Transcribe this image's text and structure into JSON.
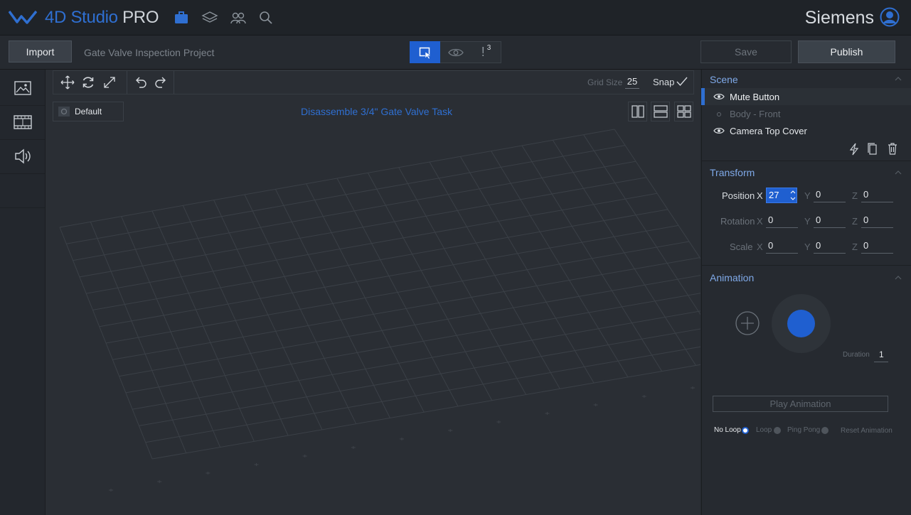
{
  "app": {
    "brand_main": "4D Studio",
    "brand_suffix": "PRO",
    "organization": "Siemens",
    "icons": [
      "logo-icon",
      "briefcase-icon",
      "layers-icon",
      "users-icon",
      "search-icon",
      "user-avatar-icon"
    ],
    "accent": "#2f6fd1"
  },
  "toolbar": {
    "import_label": "Import",
    "project_name": "Gate Valve Inspection Project",
    "alerts_count": "3",
    "alerts_symbol": "!",
    "save_label": "Save",
    "publish_label": "Publish"
  },
  "left_tabs": [
    {
      "name": "images",
      "icon": "image-icon"
    },
    {
      "name": "video",
      "icon": "film-icon"
    },
    {
      "name": "audio",
      "icon": "speaker-icon"
    }
  ],
  "viewport": {
    "tools": [
      "move-icon",
      "rotate-icon",
      "scale-icon",
      "undo-icon",
      "redo-icon"
    ],
    "grid_size_label": "Grid Size",
    "grid_size_value": "25",
    "snap_label": "Snap",
    "camera_label": "Default",
    "task_title": "Disassemble 3/4\" Gate Valve Task",
    "layouts": [
      "two-columns-icon",
      "two-rows-icon",
      "four-grid-icon"
    ]
  },
  "scene": {
    "title": "Scene",
    "items": [
      {
        "label": "Mute Button",
        "visible": true,
        "selected": true
      },
      {
        "label": "Body - Front",
        "visible": false,
        "selected": false
      },
      {
        "label": "Camera Top Cover",
        "visible": true,
        "selected": false
      }
    ]
  },
  "transform": {
    "title": "Transform",
    "position": {
      "label": "Position",
      "x": "27",
      "y": "0",
      "z": "0"
    },
    "rotation": {
      "label": "Rotation",
      "x": "0",
      "y": "0",
      "z": "0"
    },
    "scale": {
      "label": "Scale",
      "x": "0",
      "y": "0",
      "z": "0"
    },
    "axis_x": "X",
    "axis_y": "Y",
    "axis_z": "Z"
  },
  "animation": {
    "title": "Animation",
    "duration_label": "Duration",
    "duration_value": "1",
    "play_label": "Play Animation",
    "modes": [
      {
        "label": "No Loop",
        "selected": true
      },
      {
        "label": "Loop",
        "selected": false
      },
      {
        "label": "Ping Pong",
        "selected": false
      }
    ],
    "reset_label": "Reset Animation"
  }
}
